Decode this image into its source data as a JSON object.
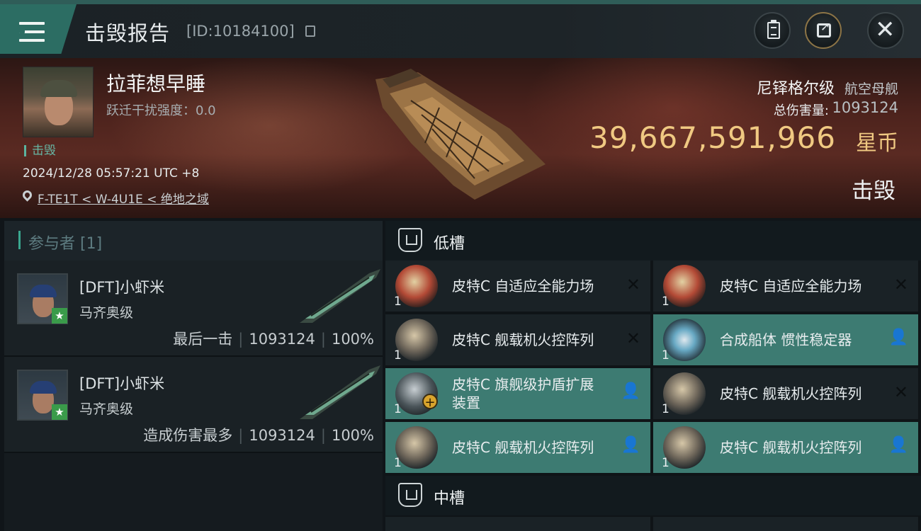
{
  "topbar": {
    "title": "击毁报告",
    "kill_id": "[ID:10184100]",
    "icons": [
      "menu-icon",
      "copy-icon",
      "clipboard-icon",
      "share-icon",
      "close-icon"
    ]
  },
  "victim": {
    "name": "拉菲想早睡",
    "warp_disruption": "跃迁干扰强度：0.0",
    "status": "击毁",
    "datetime": "2024/12/28 05:57:21 UTC +8",
    "location": "F-TE1T < W-4U1E < 绝地之域"
  },
  "ship": {
    "name": "尼铎格尔级",
    "class": "航空母舰",
    "damage_label": "总伤害量:",
    "damage_value": "1093124",
    "isk_value": "39,667,591,966",
    "isk_unit": "星币",
    "result": "击毁"
  },
  "participants": {
    "title": "参与者 [1]",
    "list": [
      {
        "name": "[DFT]小虾米",
        "ship": "马齐奥级",
        "role": "最后一击",
        "damage": "1093124",
        "percent": "100%"
      },
      {
        "name": "[DFT]小虾米",
        "ship": "马齐奥级",
        "role": "造成伤害最多",
        "damage": "1093124",
        "percent": "100%"
      }
    ]
  },
  "fitting": {
    "low_slot_title": "低槽",
    "mid_slot_title": "中槽",
    "low_modules": [
      {
        "name": "皮特C 自适应全能力场",
        "qty": "1",
        "status": "destroyed",
        "status_glyph": "✕"
      },
      {
        "name": "皮特C 自适应全能力场",
        "qty": "1",
        "status": "destroyed",
        "status_glyph": "✕"
      },
      {
        "name": "皮特C 舰载机火控阵列",
        "qty": "1",
        "status": "destroyed",
        "status_glyph": "✕"
      },
      {
        "name": "合成船体 惯性稳定器",
        "qty": "1",
        "status": "dropped",
        "status_glyph": "👤"
      },
      {
        "name": "皮特C 旗舰级护盾扩展装置",
        "qty": "1",
        "status": "dropped",
        "status_glyph": "👤"
      },
      {
        "name": "皮特C 舰载机火控阵列",
        "qty": "1",
        "status": "destroyed",
        "status_glyph": "✕"
      },
      {
        "name": "皮特C 舰载机火控阵列",
        "qty": "1",
        "status": "dropped",
        "status_glyph": "👤"
      },
      {
        "name": "皮特C 舰载机火控阵列",
        "qty": "1",
        "status": "dropped",
        "status_glyph": "👤"
      }
    ]
  },
  "colors": {
    "accent": "#3d7b72",
    "isk_gold": "#f0c982",
    "status_green": "#67b6a4"
  }
}
